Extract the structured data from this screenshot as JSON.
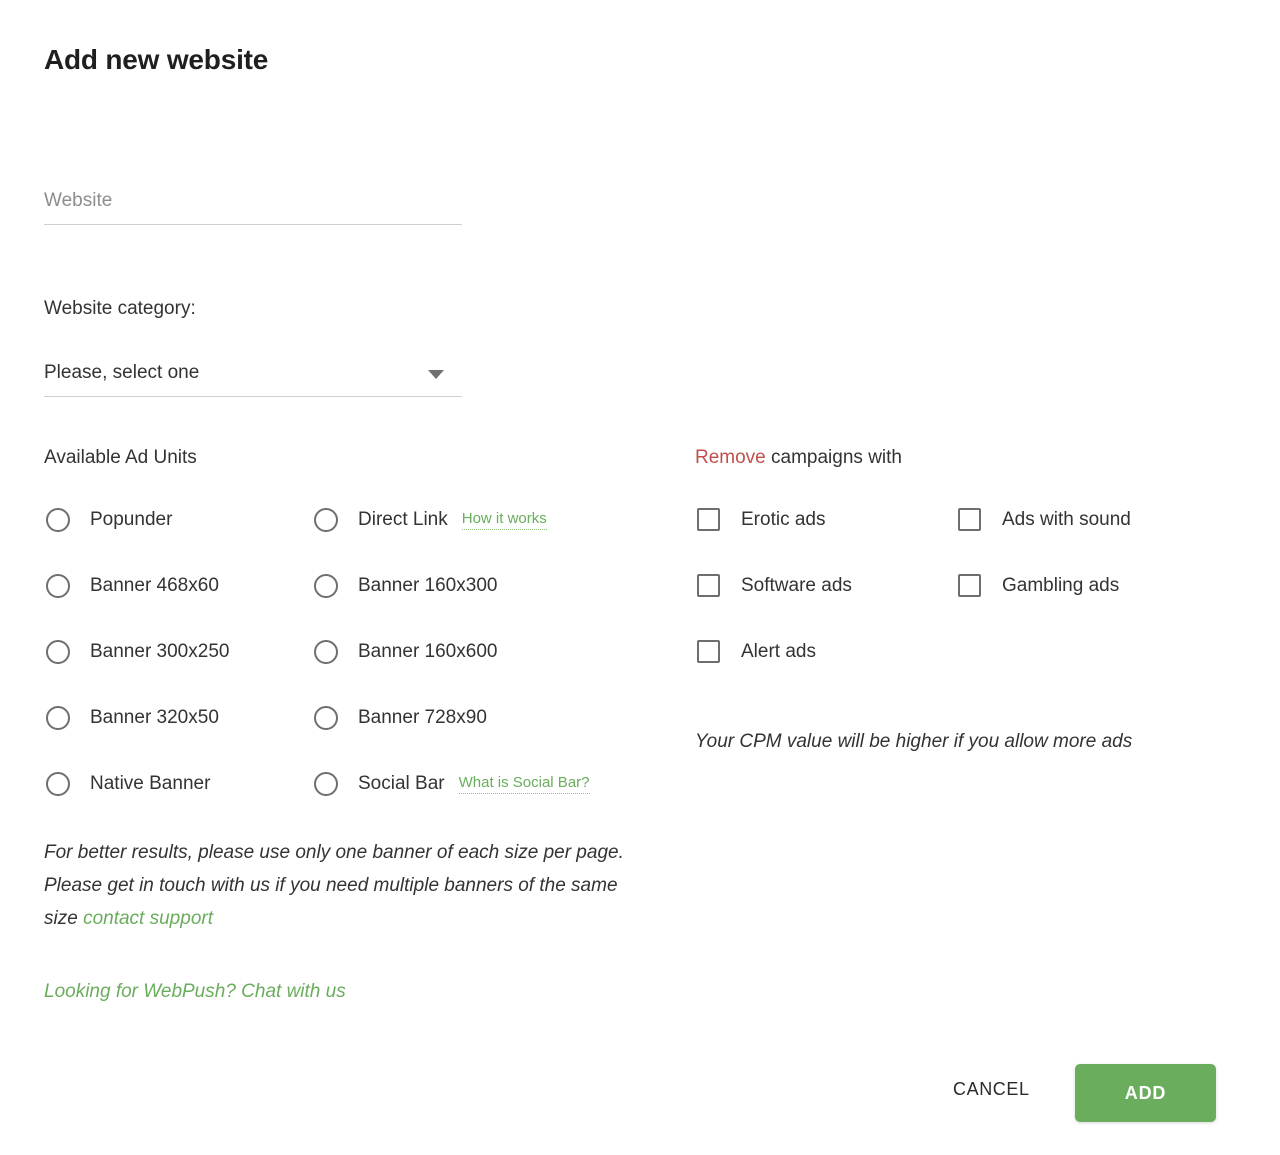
{
  "page_title": "Add new website",
  "form": {
    "website_input": {
      "value": "",
      "placeholder": "Website"
    },
    "category": {
      "label": "Website category:",
      "selected": "Please, select one",
      "chevron_icon": "chevron-down-icon"
    }
  },
  "ad_units": {
    "heading": "Available Ad Units",
    "column_left": [
      {
        "label": "Popunder",
        "selected": false
      },
      {
        "label": "Banner 468x60",
        "selected": false
      },
      {
        "label": "Banner 300x250",
        "selected": false
      },
      {
        "label": "Banner 320x50",
        "selected": false
      },
      {
        "label": "Native Banner",
        "selected": false
      }
    ],
    "column_right": [
      {
        "label": "Direct Link",
        "selected": false,
        "help_link": "How it works"
      },
      {
        "label": "Banner 160x300",
        "selected": false,
        "help_link": ""
      },
      {
        "label": "Banner 160x600",
        "selected": false,
        "help_link": ""
      },
      {
        "label": "Banner 728x90",
        "selected": false,
        "help_link": ""
      },
      {
        "label": "Social Bar",
        "selected": false,
        "help_link": "What is Social Bar?"
      }
    ]
  },
  "remove_campaigns": {
    "heading_accent": "Remove",
    "heading_rest": " campaigns with",
    "column_left": [
      {
        "label": "Erotic ads",
        "checked": false
      },
      {
        "label": "Software ads",
        "checked": false
      },
      {
        "label": "Alert ads",
        "checked": false
      }
    ],
    "column_right": [
      {
        "label": "Ads with sound",
        "checked": false
      },
      {
        "label": "Gambling ads",
        "checked": false
      }
    ],
    "cpm_note": "Your CPM value will be higher if you allow more ads"
  },
  "notes": {
    "banner_line1": "For better results, please use only one banner of each size per page.",
    "banner_line2": "Please get in touch with us if you need multiple banners of the same size ",
    "contact_link": "contact support",
    "webpush": "Looking for WebPush? Chat with us"
  },
  "footer": {
    "cancel_label": "CANCEL",
    "add_label": "ADD"
  },
  "colors": {
    "accent_green": "#6aad5c",
    "accent_red": "#c0504a",
    "text": "#333333",
    "placeholder": "#8d8d8d",
    "control_border": "#6e6e6e",
    "underline": "#cfcfcf"
  }
}
